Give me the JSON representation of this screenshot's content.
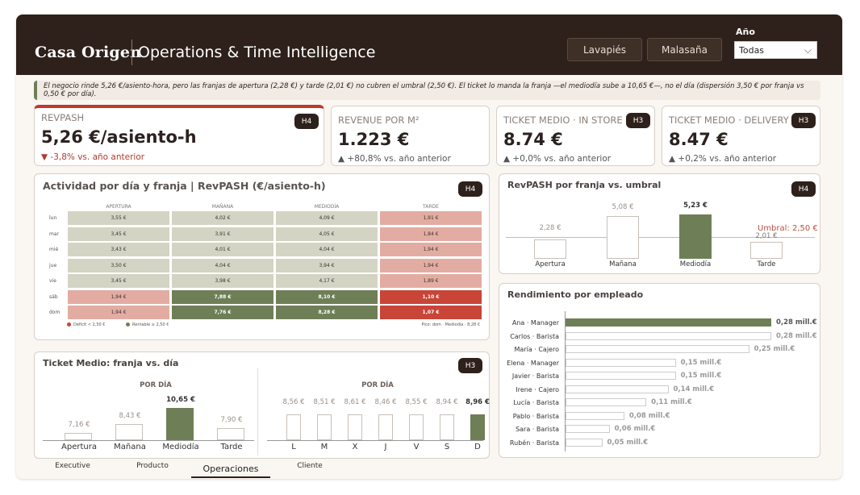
{
  "header": {
    "brand": "Casa Origen",
    "title": "Operations & Time Intelligence",
    "buttons": [
      "Lavapiés",
      "Malasaña"
    ],
    "year_label": "Año",
    "year_value": "Todas"
  },
  "insight": "El negocio rinde 5,26 €/asiento-hora, pero las franjas de apertura (2,28 €) y tarde (2,01 €) no cubren el umbral (2,50 €). El ticket lo manda la franja —el mediodía sube a 10,65 €—, no el día (dispersión 3,50 € por franja vs 0,50 € por día).",
  "kpis": [
    {
      "label": "RevPASH",
      "value": "5,26 €/asiento-h",
      "delta": "▼ -3,8% vs. año anterior",
      "badge": "H4",
      "trend": "down"
    },
    {
      "label": "Revenue por m²",
      "value": "1.223 €",
      "delta": "▲ +80,8% vs. año anterior",
      "badge": "",
      "trend": "up"
    },
    {
      "label": "Ticket medio · In store",
      "value": "8.74 €",
      "delta": "▲ +0,0% vs. año anterior",
      "badge": "H3",
      "trend": "up"
    },
    {
      "label": "Ticket medio · Delivery",
      "value": "8.47 €",
      "delta": "▲ +0,2% vs. año anterior",
      "badge": "H3",
      "trend": "up"
    }
  ],
  "heatmap": {
    "title": "Actividad por día y franja | RevPASH (€/asiento-h)",
    "badge": "H4",
    "columns": [
      "Apertura",
      "Mañana",
      "Mediodía",
      "Tarde"
    ],
    "rows": [
      {
        "day": "lun",
        "values": [
          "3,55 €",
          "4,02 €",
          "4,09 €",
          "1,91 €"
        ]
      },
      {
        "day": "mar",
        "values": [
          "3,45 €",
          "3,91 €",
          "4,05 €",
          "1,84 €"
        ]
      },
      {
        "day": "mié",
        "values": [
          "3,43 €",
          "4,01 €",
          "4,04 €",
          "1,94 €"
        ]
      },
      {
        "day": "jue",
        "values": [
          "3,50 €",
          "4,04 €",
          "3,94 €",
          "1,94 €"
        ]
      },
      {
        "day": "vie",
        "values": [
          "3,45 €",
          "3,98 €",
          "4,17 €",
          "1,89 €"
        ]
      },
      {
        "day": "sáb",
        "values": [
          "1,94 €",
          "7,88 €",
          "8,10 €",
          "1,10 €"
        ]
      },
      {
        "day": "dom",
        "values": [
          "1,94 €",
          "7,76 €",
          "8,28 €",
          "1,07 €"
        ]
      }
    ],
    "legend_deficit": "Déficit < 2,50 €",
    "legend_rentable": "Rentable ≥ 2,50 €",
    "note": "Pico: dom · Mediodía · 8,28 €",
    "colors": {
      "neutral": "#d4d4c4",
      "rentable": "#6e7f57",
      "low": "#e3aca2",
      "deficit": "#c84538"
    }
  },
  "revpash": {
    "title": "RevPASH por franja vs. umbral",
    "badge": "H4",
    "threshold_label": "Umbral: 2,50 €",
    "threshold": 2.5,
    "bars": [
      {
        "label": "Apertura",
        "value": 2.28,
        "text": "2,28 €"
      },
      {
        "label": "Mañana",
        "value": 5.08,
        "text": "5,08 €"
      },
      {
        "label": "Mediodía",
        "value": 5.23,
        "text": "5,23 €"
      },
      {
        "label": "Tarde",
        "value": 2.01,
        "text": "2,01 €"
      }
    ]
  },
  "employees": {
    "title": "Rendimiento por empleado",
    "items": [
      {
        "name": "Ana · Manager",
        "value": 0.28,
        "text": "0,28 mill.€"
      },
      {
        "name": "Carlos · Barista",
        "value": 0.28,
        "text": "0,28 mill.€"
      },
      {
        "name": "María · Cajero",
        "value": 0.25,
        "text": "0,25 mill.€"
      },
      {
        "name": "Elena · Manager",
        "value": 0.15,
        "text": "0,15 mill.€"
      },
      {
        "name": "Javier · Barista",
        "value": 0.15,
        "text": "0,15 mill.€"
      },
      {
        "name": "Irene · Cajero",
        "value": 0.14,
        "text": "0,14 mill.€"
      },
      {
        "name": "Lucía · Barista",
        "value": 0.11,
        "text": "0,11 mill.€"
      },
      {
        "name": "Pablo · Barista",
        "value": 0.08,
        "text": "0,08 mill.€"
      },
      {
        "name": "Sara · Barista",
        "value": 0.06,
        "text": "0,06 mill.€"
      },
      {
        "name": "Rubén · Barista",
        "value": 0.05,
        "text": "0,05 mill.€"
      }
    ]
  },
  "ticket": {
    "title": "Ticket Medio: franja vs. día",
    "badge": "H3",
    "left_subtitle": "POR DÍA",
    "right_subtitle": "POR DÍA",
    "franjas": [
      {
        "label": "Apertura",
        "value": 7.16,
        "text": "7,16 €"
      },
      {
        "label": "Mañana",
        "value": 8.43,
        "text": "8,43 €"
      },
      {
        "label": "Mediodía",
        "value": 10.65,
        "text": "10,65 €"
      },
      {
        "label": "Tarde",
        "value": 7.9,
        "text": "7,90 €"
      }
    ],
    "dias": [
      {
        "label": "L",
        "value": 8.56,
        "text": "8,56 €"
      },
      {
        "label": "M",
        "value": 8.51,
        "text": "8,51 €"
      },
      {
        "label": "X",
        "value": 8.61,
        "text": "8,61 €"
      },
      {
        "label": "J",
        "value": 8.46,
        "text": "8,46 €"
      },
      {
        "label": "V",
        "value": 8.55,
        "text": "8,55 €"
      },
      {
        "label": "S",
        "value": 8.94,
        "text": "8,94 €"
      },
      {
        "label": "D",
        "value": 8.96,
        "text": "8,96 €"
      }
    ]
  },
  "tabs": [
    "Executive",
    "Producto",
    "Operaciones",
    "Cliente"
  ],
  "active_tab": "Operaciones"
}
